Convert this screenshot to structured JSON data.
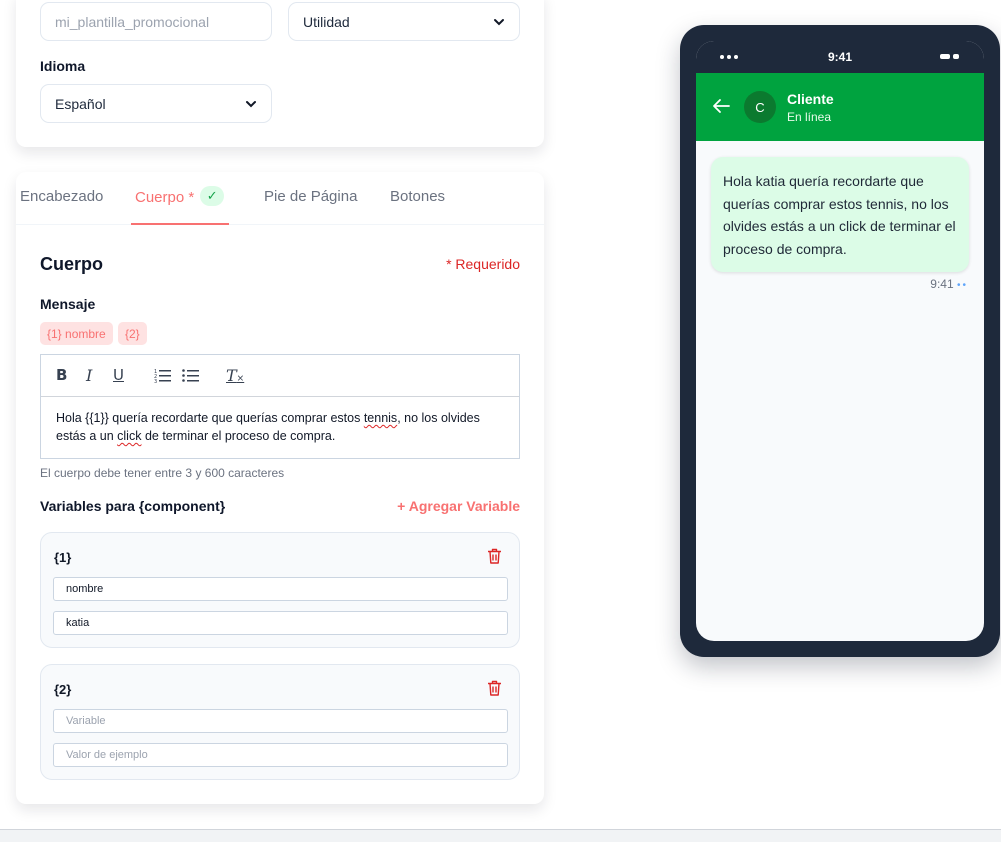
{
  "form": {
    "name_placeholder": "mi_plantilla_promocional",
    "category_value": "Utilidad",
    "language_label": "Idioma",
    "language_value": "Español"
  },
  "tabs": [
    {
      "label": "Encabezado"
    },
    {
      "label": "Cuerpo *",
      "badge": "✓"
    },
    {
      "label": "Pie de Página"
    },
    {
      "label": "Botones"
    }
  ],
  "body": {
    "title": "Cuerpo",
    "required": "* Requerido",
    "message_label": "Mensaje",
    "chips": [
      "{1} nombre",
      "{2}"
    ],
    "toolbar": {
      "bold": "B",
      "italic": "I",
      "underline": "U",
      "clear": "T"
    },
    "text_parts": {
      "p1": "Hola  {{1}}  quería recordarte que querías comprar estos ",
      "p2": "tennis",
      "p3": ", no los olvides estás a un ",
      "p4": "click",
      "p5": " de terminar el proceso de compra."
    },
    "hint": "El cuerpo debe tener entre 3 y 600 caracteres"
  },
  "variables": {
    "title": "Variables para {component}",
    "add_label": "+ Agregar Variable",
    "items": [
      {
        "name": "{1}",
        "variable": "nombre",
        "example": "katia"
      },
      {
        "name": "{2}",
        "variable_placeholder": "Variable",
        "example_placeholder": "Valor de ejemplo"
      }
    ]
  },
  "preview": {
    "time": "9:41",
    "contact": "Cliente",
    "contact_initial": "C",
    "status": "En línea",
    "message": "Hola katia quería recordarte que querías comprar estos tennis, no los olvides estás a un click de terminar el proceso de compra.",
    "message_time": "9:41"
  },
  "colors": {
    "accent": "#f87171",
    "whatsapp_green": "#00a33f",
    "phone_frame": "#1e293b",
    "bubble": "#dcfce7",
    "required": "#dc2626"
  }
}
